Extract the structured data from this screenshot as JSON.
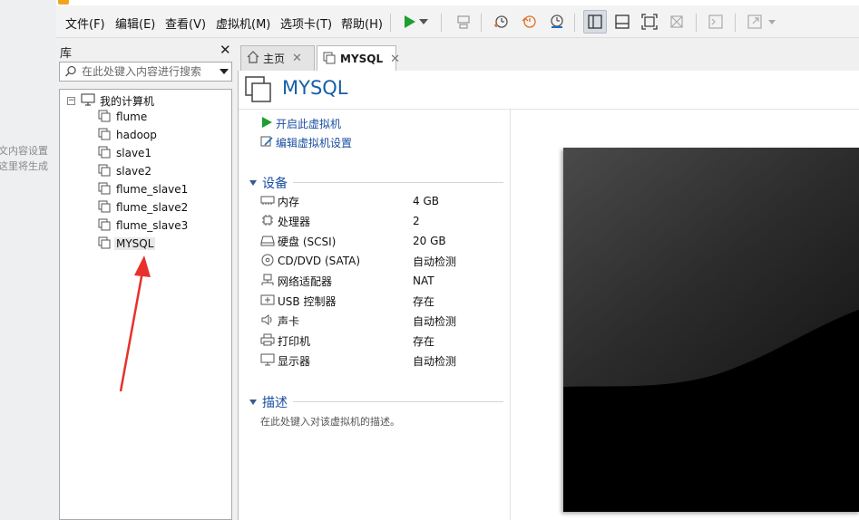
{
  "background_window": {
    "line1": "文内容设置",
    "line2": "这里将生成"
  },
  "menubar": {
    "items": [
      "文件(F)",
      "编辑(E)",
      "查看(V)",
      "虚拟机(M)",
      "选项卡(T)",
      "帮助(H)"
    ]
  },
  "toolbar": {
    "icons": [
      "play-icon",
      "dropdown-arrow-icon",
      "send-keys-icon",
      "snapshot-icon",
      "revert-snapshot-icon",
      "snapshot-manager-icon",
      "library-view-icon",
      "thumbnail-bar-icon",
      "fullscreen-icon",
      "unity-icon",
      "console-icon",
      "stretch-icon"
    ]
  },
  "library": {
    "title": "库",
    "close": "✕",
    "search_placeholder": "在此处键入内容进行搜索",
    "root": {
      "toggle": "−",
      "label": "我的计算机"
    },
    "vms": [
      "flume",
      "hadoop",
      "slave1",
      "slave2",
      "flume_slave1",
      "flume_slave2",
      "flume_slave3",
      "MYSQL"
    ],
    "selected": "MYSQL"
  },
  "tabs": [
    {
      "label": "主页",
      "close": "✕",
      "active": false
    },
    {
      "label": "MYSQL",
      "close": "✕",
      "active": true
    }
  ],
  "vm": {
    "title": "MYSQL",
    "actions": {
      "power_on": "开启此虚拟机",
      "edit_settings": "编辑虚拟机设置"
    },
    "devices_title": "设备",
    "devices": [
      {
        "name": "内存",
        "value": "4 GB",
        "icon": "memory-icon"
      },
      {
        "name": "处理器",
        "value": "2",
        "icon": "cpu-icon"
      },
      {
        "name": "硬盘 (SCSI)",
        "value": "20 GB",
        "icon": "hard-disk-icon"
      },
      {
        "name": "CD/DVD (SATA)",
        "value": "自动检测",
        "icon": "cd-dvd-icon"
      },
      {
        "name": "网络适配器",
        "value": "NAT",
        "icon": "network-adapter-icon"
      },
      {
        "name": "USB 控制器",
        "value": "存在",
        "icon": "usb-icon"
      },
      {
        "name": "声卡",
        "value": "自动检测",
        "icon": "sound-card-icon"
      },
      {
        "name": "打印机",
        "value": "存在",
        "icon": "printer-icon"
      },
      {
        "name": "显示器",
        "value": "自动检测",
        "icon": "display-icon"
      }
    ],
    "description_title": "描述",
    "description_placeholder": "在此处键入对该虚拟机的描述。"
  },
  "colors": {
    "accent_blue": "#1560a8",
    "play_green": "#1e9e2e",
    "annotation_red": "#e8302c"
  }
}
